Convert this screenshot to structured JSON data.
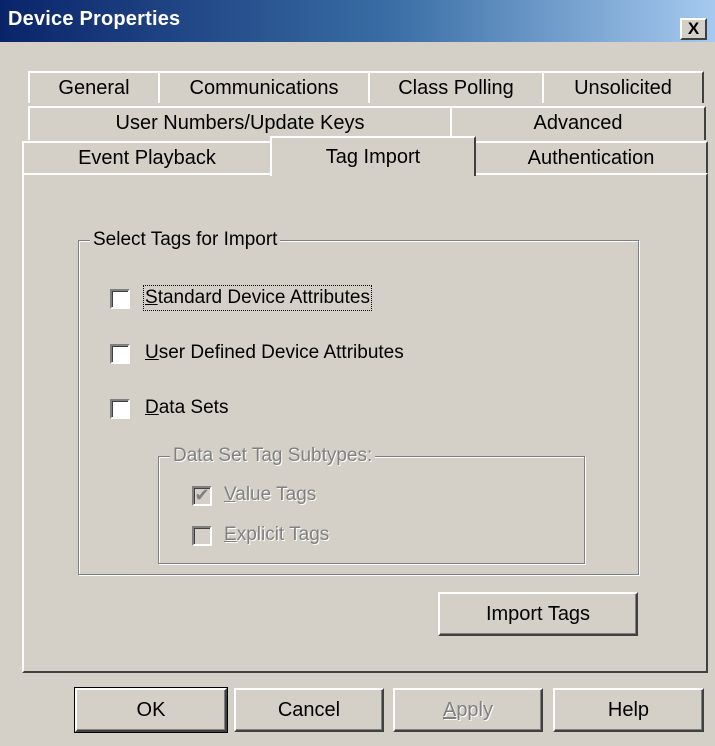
{
  "window": {
    "title": "Device Properties",
    "close_label": "X"
  },
  "tabs": {
    "row1": [
      "General",
      "Communications",
      "Class Polling",
      "Unsolicited"
    ],
    "row2": [
      "User Numbers/Update Keys",
      "Advanced"
    ],
    "row3": [
      "Event Playback",
      "Tag Import",
      "Authentication"
    ],
    "active": "Tag Import"
  },
  "group": {
    "title": "Select Tags for Import",
    "options": [
      {
        "label": "Standard Device Attributes",
        "checked": false,
        "focused": true
      },
      {
        "label": "User Defined Device Attributes",
        "checked": false
      },
      {
        "label": "Data Sets",
        "checked": false
      }
    ]
  },
  "subgroup": {
    "title": "Data Set Tag Subtypes:",
    "enabled": false,
    "options": [
      {
        "label": "Value Tags",
        "checked": true
      },
      {
        "label": "Explicit Tags",
        "checked": false
      }
    ]
  },
  "buttons": {
    "import": "Import Tags",
    "ok": "OK",
    "cancel": "Cancel",
    "apply": "Apply",
    "help": "Help"
  }
}
